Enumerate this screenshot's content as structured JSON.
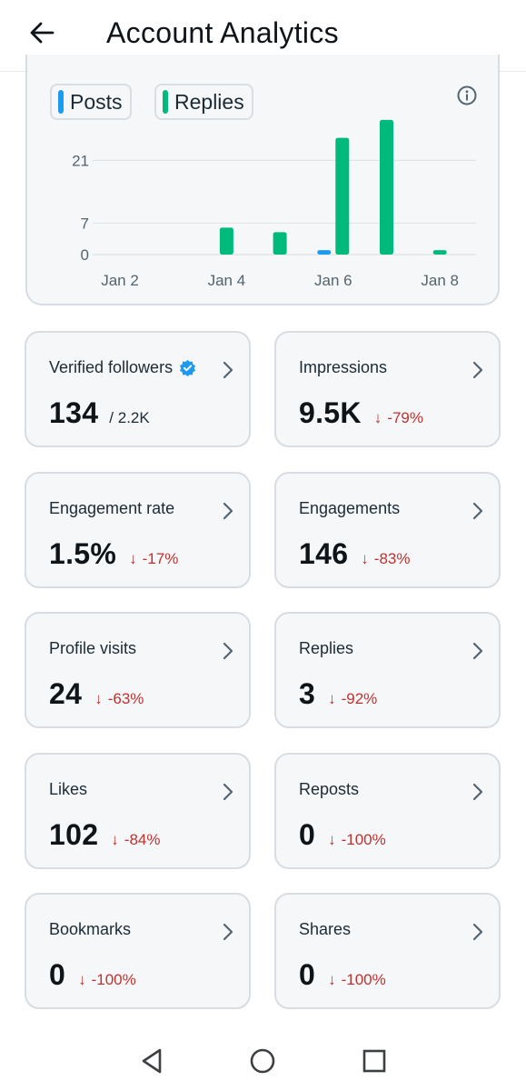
{
  "header": {
    "title": "Account Analytics",
    "back_icon": "arrow-left-icon"
  },
  "chart": {
    "legend": [
      {
        "label": "Posts",
        "color": "#1d9bf0"
      },
      {
        "label": "Replies",
        "color": "#00ba7c"
      }
    ],
    "info_icon": "info-icon"
  },
  "chart_data": {
    "type": "bar",
    "categories": [
      "Jan 2",
      "Jan 3",
      "Jan 4",
      "Jan 5",
      "Jan 6",
      "Jan 7",
      "Jan 8"
    ],
    "x_tick_labels": [
      "Jan 2",
      "Jan 4",
      "Jan 6",
      "Jan 8"
    ],
    "series": [
      {
        "name": "Posts",
        "color": "#1d9bf0",
        "values": [
          0,
          0,
          0,
          0,
          1,
          0,
          0
        ]
      },
      {
        "name": "Replies",
        "color": "#00ba7c",
        "values": [
          0,
          0,
          6,
          5,
          26,
          30,
          1
        ]
      }
    ],
    "y_ticks": [
      "0",
      "7",
      "21"
    ],
    "ylim": [
      0,
      31
    ],
    "grid": true
  },
  "stats": [
    {
      "label": "Verified followers",
      "value": "134",
      "total": "/ 2.2K",
      "change": "",
      "verified": true
    },
    {
      "label": "Impressions",
      "value": "9.5K",
      "change": "-79%"
    },
    {
      "label": "Engagement rate",
      "value": "1.5%",
      "change": "-17%"
    },
    {
      "label": "Engagements",
      "value": "146",
      "change": "-83%"
    },
    {
      "label": "Profile visits",
      "value": "24",
      "change": "-63%"
    },
    {
      "label": "Replies",
      "value": "3",
      "change": "-92%"
    },
    {
      "label": "Likes",
      "value": "102",
      "change": "-84%"
    },
    {
      "label": "Reposts",
      "value": "0",
      "change": "-100%"
    },
    {
      "label": "Bookmarks",
      "value": "0",
      "change": "-100%"
    },
    {
      "label": "Shares",
      "value": "0",
      "change": "-100%"
    }
  ],
  "change_arrow": "↓",
  "colors": {
    "negative": "#c0322f",
    "card_bg": "#f5f7f8",
    "card_border": "#d7dde2"
  },
  "navbar": {
    "icons": [
      "back-triangle-icon",
      "home-circle-icon",
      "recents-square-icon"
    ]
  }
}
